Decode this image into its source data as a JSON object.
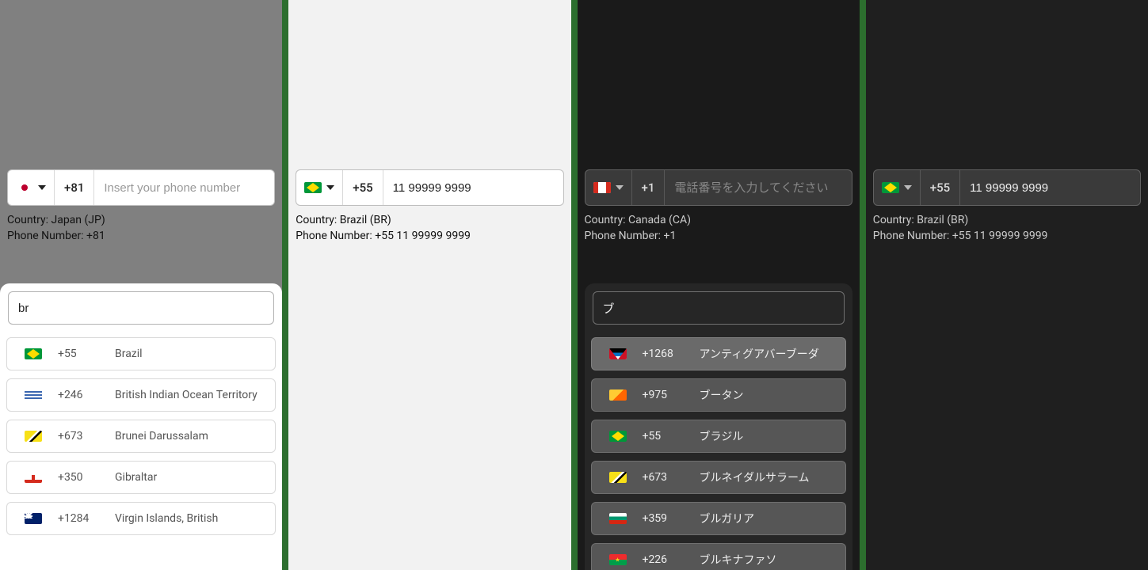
{
  "panels": [
    {
      "theme": "light",
      "flag": "jp",
      "dial_code": "+81",
      "placeholder": "Insert your phone number",
      "value": "",
      "country_line": "Country: Japan (JP)",
      "phone_line": "Phone Number: +81",
      "modal": {
        "theme": "light",
        "search": "br",
        "options": [
          {
            "flag": "br",
            "dial": "+55",
            "name": "Brazil"
          },
          {
            "flag": "io",
            "dial": "+246",
            "name": "British Indian Ocean Territory"
          },
          {
            "flag": "bn",
            "dial": "+673",
            "name": "Brunei Darussalam"
          },
          {
            "flag": "gi",
            "dial": "+350",
            "name": "Gibraltar"
          },
          {
            "flag": "vg",
            "dial": "+1284",
            "name": "Virgin Islands, British"
          }
        ]
      }
    },
    {
      "theme": "white",
      "flag": "br",
      "dial_code": "+55",
      "placeholder": "",
      "value": "11 99999 9999",
      "country_line": "Country: Brazil (BR)",
      "phone_line": "Phone Number: +55 11 99999 9999",
      "modal": null
    },
    {
      "theme": "dark",
      "flag": "ca",
      "dial_code": "+1",
      "placeholder": "電話番号を入力してください",
      "value": "",
      "country_line": "Country: Canada (CA)",
      "phone_line": "Phone Number: +1",
      "modal": {
        "theme": "dark",
        "search": "ブ",
        "options": [
          {
            "flag": "ag",
            "dial": "+1268",
            "name": "アンティグアバーブーダ",
            "highlight": true
          },
          {
            "flag": "bt",
            "dial": "+975",
            "name": "ブータン"
          },
          {
            "flag": "br",
            "dial": "+55",
            "name": "ブラジル"
          },
          {
            "flag": "bn",
            "dial": "+673",
            "name": "ブルネイダルサラーム"
          },
          {
            "flag": "bg",
            "dial": "+359",
            "name": "ブルガリア"
          },
          {
            "flag": "bf",
            "dial": "+226",
            "name": "ブルキナファソ"
          }
        ]
      }
    },
    {
      "theme": "dark2",
      "flag": "br",
      "dial_code": "+55",
      "placeholder": "",
      "value": "11 99999 9999",
      "country_line": "Country: Brazil (BR)",
      "phone_line": "Phone Number: +55 11 99999 9999",
      "modal": null
    }
  ]
}
